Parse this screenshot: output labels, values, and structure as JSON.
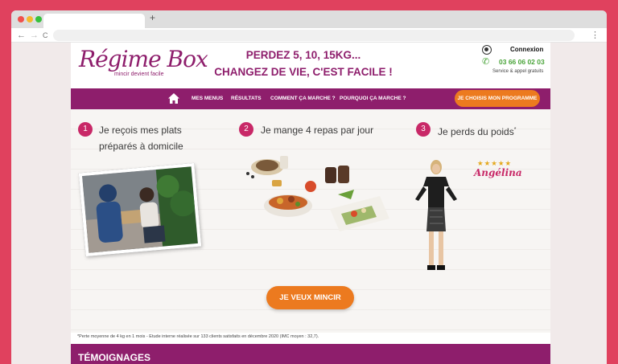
{
  "browser": {
    "new_tab_label": "+",
    "back": "←",
    "forward": "→",
    "reload": "C",
    "menu": "⋮"
  },
  "colors": {
    "frame": "#e0415e",
    "brand": "#8e1e6c",
    "accent": "#ec7a1f",
    "pink": "#c82867",
    "green": "#4aa43a"
  },
  "header": {
    "logo": "Régime Box",
    "logo_tagline": "mincir devient facile",
    "headline_1": "PERDEZ 5, 10, 15KG...",
    "headline_2": "CHANGEZ DE VIE, C'EST FACILE !",
    "login": "Connexion",
    "phone": "03 66 06 02 03",
    "service": "Service & appel gratuits"
  },
  "nav": {
    "home_icon": "home-icon",
    "items": [
      {
        "label": "MES MENUS"
      },
      {
        "label": "RÉSULTATS"
      },
      {
        "label": "COMMENT ÇA MARCHE ?"
      },
      {
        "label": "POURQUOI ÇA MARCHE ?"
      }
    ],
    "cta": "JE CHOISIS MON PROGRAMME"
  },
  "steps": [
    {
      "number": "1",
      "line1": "Je reçois mes plats",
      "line2": "préparés à domicile"
    },
    {
      "number": "2",
      "line1": "Je mange 4 repas par jour"
    },
    {
      "number": "3",
      "line1": "Je perds du poids",
      "sup": "*"
    }
  ],
  "testimonial": {
    "stars": "★★★★★",
    "rating": 5,
    "name": "Angélina"
  },
  "cta": "JE VEUX MINCIR",
  "footnote": "*Perte moyenne de 4 kg en 1 mois - Etude interne réalisée sur 133 clients satisfaits en décembre 2020 (IMC moyen : 32,7).",
  "section_title": "TÉMOIGNAGES"
}
